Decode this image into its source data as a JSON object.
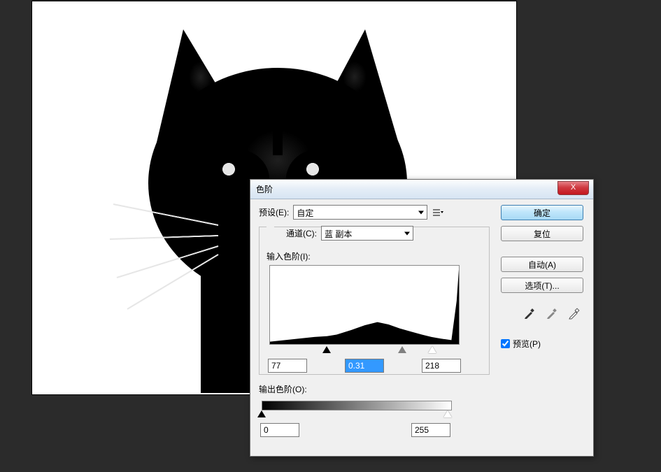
{
  "dialog": {
    "title": "色阶",
    "close_glyph": "X",
    "preset_label": "预设(E):",
    "preset_value": "自定",
    "channel_label": "通道(C):",
    "channel_value": "蓝 副本",
    "input_levels_label": "输入色阶(I):",
    "output_levels_label": "输出色阶(O):",
    "input_black": "77",
    "input_gamma": "0.31",
    "input_white": "218",
    "output_black": "0",
    "output_white": "255",
    "buttons": {
      "ok": "确定",
      "cancel": "复位",
      "auto": "自动(A)",
      "options": "选项(T)..."
    },
    "preview_label": "预览(P)",
    "preview_checked": true
  },
  "chart_data": {
    "type": "area",
    "title": "",
    "xlabel": "",
    "ylabel": "",
    "xlim": [
      0,
      255
    ],
    "ylim": [
      0,
      100
    ],
    "series": [
      {
        "name": "histogram",
        "x": [
          0,
          20,
          40,
          60,
          77,
          90,
          110,
          128,
          145,
          160,
          175,
          190,
          205,
          218,
          230,
          245,
          252,
          255
        ],
        "values": [
          3,
          5,
          7,
          9,
          10,
          12,
          18,
          24,
          28,
          25,
          20,
          16,
          12,
          9,
          7,
          5,
          55,
          95
        ]
      }
    ],
    "markers": {
      "black": 77,
      "gamma": 0.31,
      "white": 218
    },
    "output_range": [
      0,
      255
    ]
  }
}
